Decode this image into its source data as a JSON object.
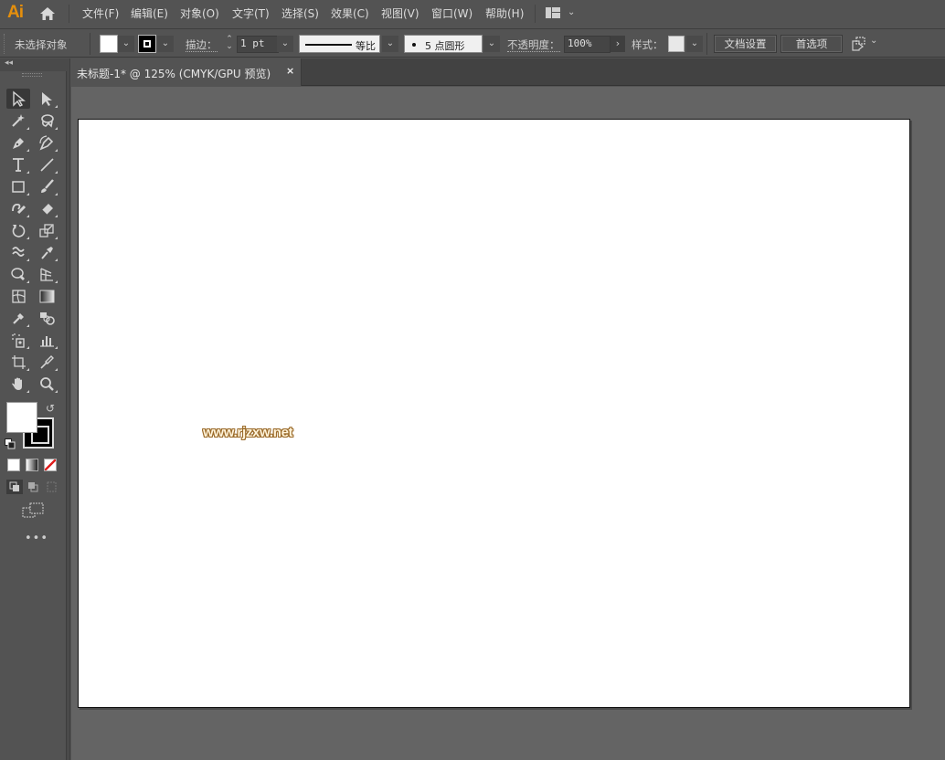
{
  "app": {
    "logo": "Ai",
    "accent": "#ff9a00"
  },
  "menu": {
    "items": [
      {
        "label": "文件(F)"
      },
      {
        "label": "编辑(E)"
      },
      {
        "label": "对象(O)"
      },
      {
        "label": "文字(T)"
      },
      {
        "label": "选择(S)"
      },
      {
        "label": "效果(C)"
      },
      {
        "label": "视图(V)"
      },
      {
        "label": "窗口(W)"
      },
      {
        "label": "帮助(H)"
      }
    ],
    "workspace_icon": "workspace-layout-icon"
  },
  "control": {
    "selection_status": "未选择对象",
    "fill_color": "#ffffff",
    "stroke_color": "#000000",
    "stroke_label": "描边：",
    "stroke_weight": "1 pt",
    "stroke_profile": "等比",
    "brush": "5 点圆形",
    "opacity_label": "不透明度：",
    "opacity_value": "100%",
    "style_label": "样式：",
    "doc_setup_button": "文档设置",
    "preferences_button": "首选项",
    "arrange_icon": "arrange-documents-icon"
  },
  "document": {
    "tab_title": "未标题-1* @ 125% (CMYK/GPU 预览)",
    "close_glyph": "×"
  },
  "tools": [
    {
      "name": "selection-tool",
      "active": true
    },
    {
      "name": "direct-selection-tool"
    },
    {
      "name": "magic-wand-tool"
    },
    {
      "name": "lasso-tool"
    },
    {
      "name": "pen-tool"
    },
    {
      "name": "curvature-tool"
    },
    {
      "name": "type-tool"
    },
    {
      "name": "line-segment-tool"
    },
    {
      "name": "rectangle-tool"
    },
    {
      "name": "paintbrush-tool"
    },
    {
      "name": "shaper-tool"
    },
    {
      "name": "eraser-tool"
    },
    {
      "name": "rotate-tool"
    },
    {
      "name": "scale-tool"
    },
    {
      "name": "warp-tool"
    },
    {
      "name": "puppet-warp-tool"
    },
    {
      "name": "shape-builder-tool"
    },
    {
      "name": "perspective-grid-tool"
    },
    {
      "name": "mesh-tool"
    },
    {
      "name": "gradient-tool"
    },
    {
      "name": "eyedropper-tool"
    },
    {
      "name": "blend-tool"
    },
    {
      "name": "symbol-sprayer-tool"
    },
    {
      "name": "column-graph-tool"
    },
    {
      "name": "artboard-tool"
    },
    {
      "name": "slice-tool"
    },
    {
      "name": "hand-tool"
    },
    {
      "name": "zoom-tool"
    }
  ],
  "color_controls": {
    "fill": "#ffffff",
    "stroke": "#000000",
    "more_tools": "•••"
  },
  "canvas": {
    "watermark": "www.rjzxw.net"
  }
}
